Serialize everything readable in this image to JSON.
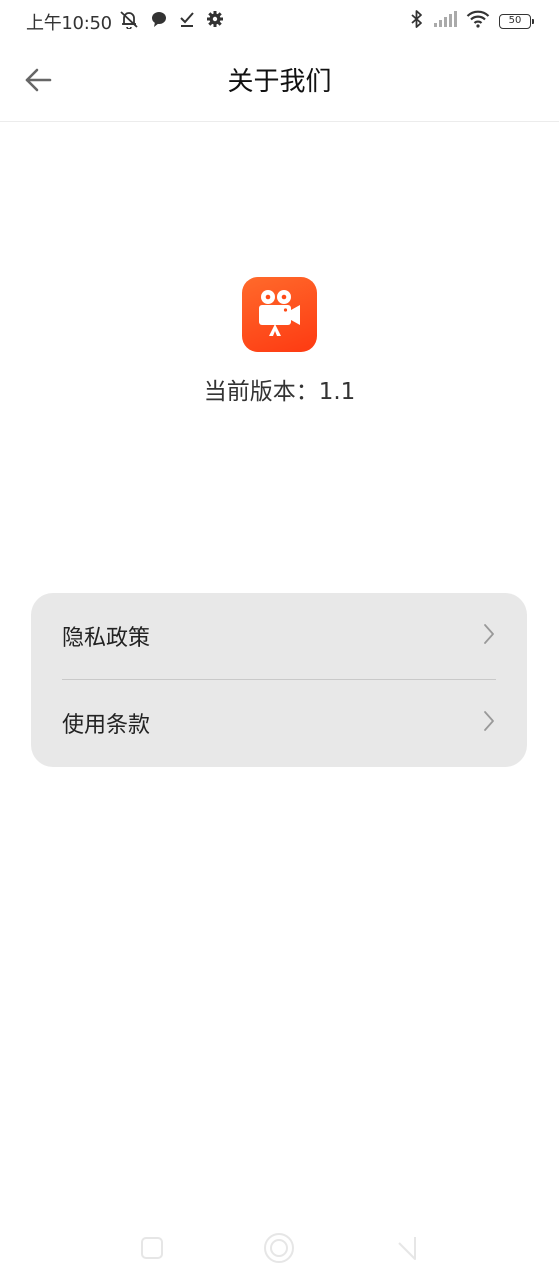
{
  "status_bar": {
    "time": "上午10:50",
    "battery_level": "50",
    "icons_left": [
      "notifications-muted-icon",
      "message-bubble-icon",
      "checkmark-icon",
      "gear-icon"
    ],
    "icons_right": [
      "bluetooth-icon",
      "cellular-signal-icon",
      "wifi-icon",
      "battery-icon"
    ]
  },
  "header": {
    "title": "关于我们",
    "back_icon": "arrow-left-icon"
  },
  "app_info": {
    "logo_icon": "video-camera-icon",
    "logo_color": "#fe4a17",
    "version_text": "当前版本：1.1"
  },
  "menu": {
    "items": [
      {
        "label": "隐私政策",
        "icon": "chevron-right-icon"
      },
      {
        "label": "使用条款",
        "icon": "chevron-right-icon"
      }
    ]
  },
  "nav_bar": {
    "buttons": [
      "recent-apps-icon",
      "home-icon",
      "back-icon"
    ]
  }
}
